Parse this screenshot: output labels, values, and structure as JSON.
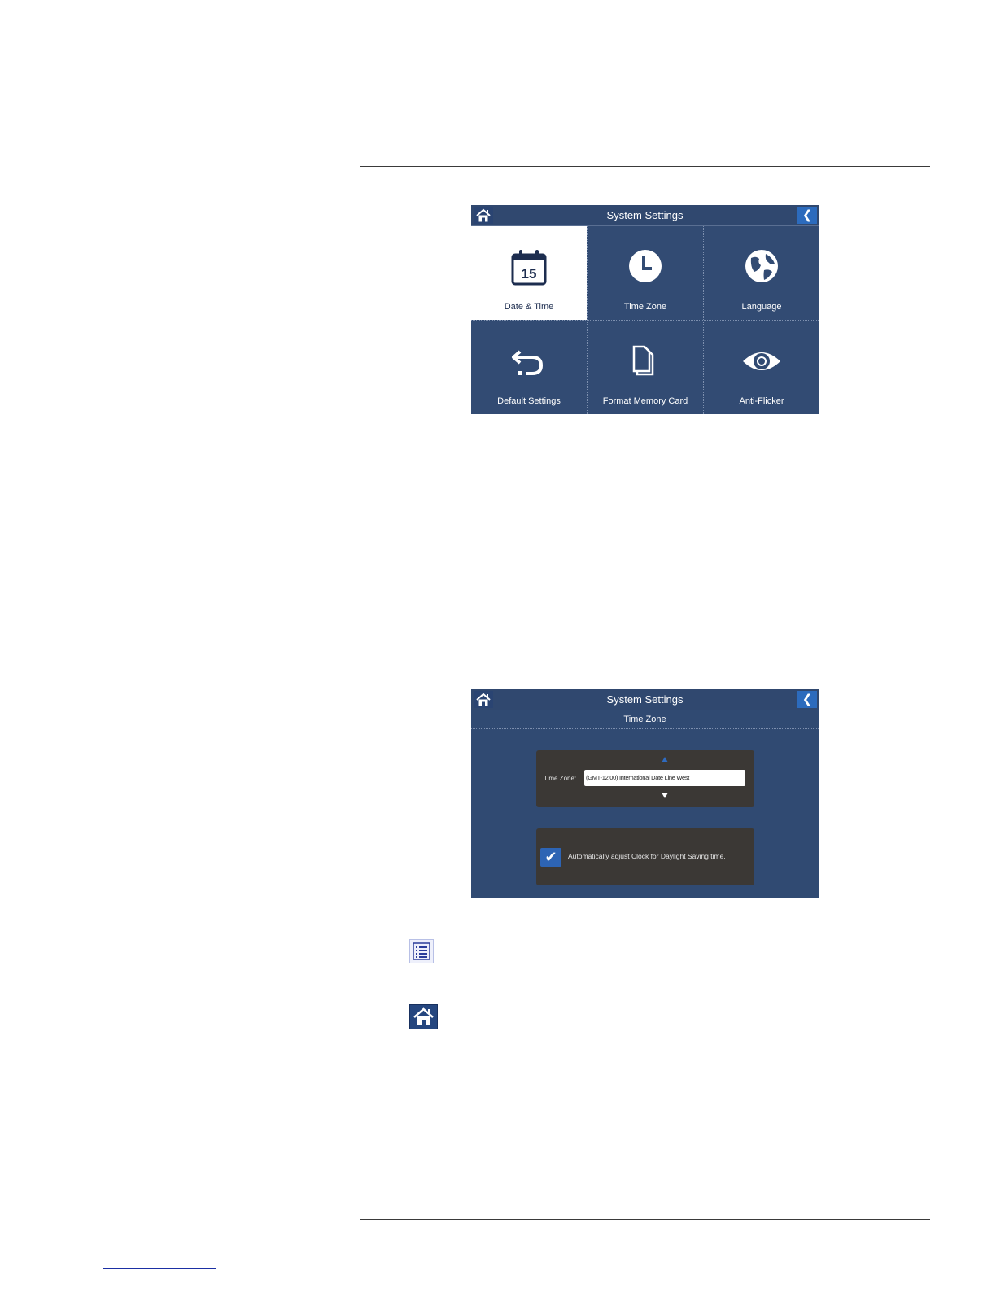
{
  "screen1": {
    "title": "System Settings",
    "tiles": [
      {
        "label": "Date & Time",
        "icon": "calendar-icon",
        "day": "15",
        "selected": true
      },
      {
        "label": "Time Zone",
        "icon": "clock-icon"
      },
      {
        "label": "Language",
        "icon": "globe-icon"
      },
      {
        "label": "Default Settings",
        "icon": "undo-icon"
      },
      {
        "label": "Format Memory Card",
        "icon": "memory-card-icon"
      },
      {
        "label": "Anti-Flicker",
        "icon": "eye-icon"
      }
    ],
    "back_glyph": "❮"
  },
  "screen2": {
    "title": "System Settings",
    "subtitle": "Time Zone",
    "time_zone_label": "Time Zone:",
    "time_zone_value": "(GMT-12:00) International Date Line West",
    "dst_checked": true,
    "dst_label": "Automatically adjust Clock for Daylight Saving time.",
    "back_glyph": "❮"
  },
  "icons": {
    "list": "list-icon",
    "home": "home-icon"
  },
  "colors": {
    "screen_bg": "#304a72",
    "accent": "#2d64b4",
    "panel": "#3b3835"
  }
}
